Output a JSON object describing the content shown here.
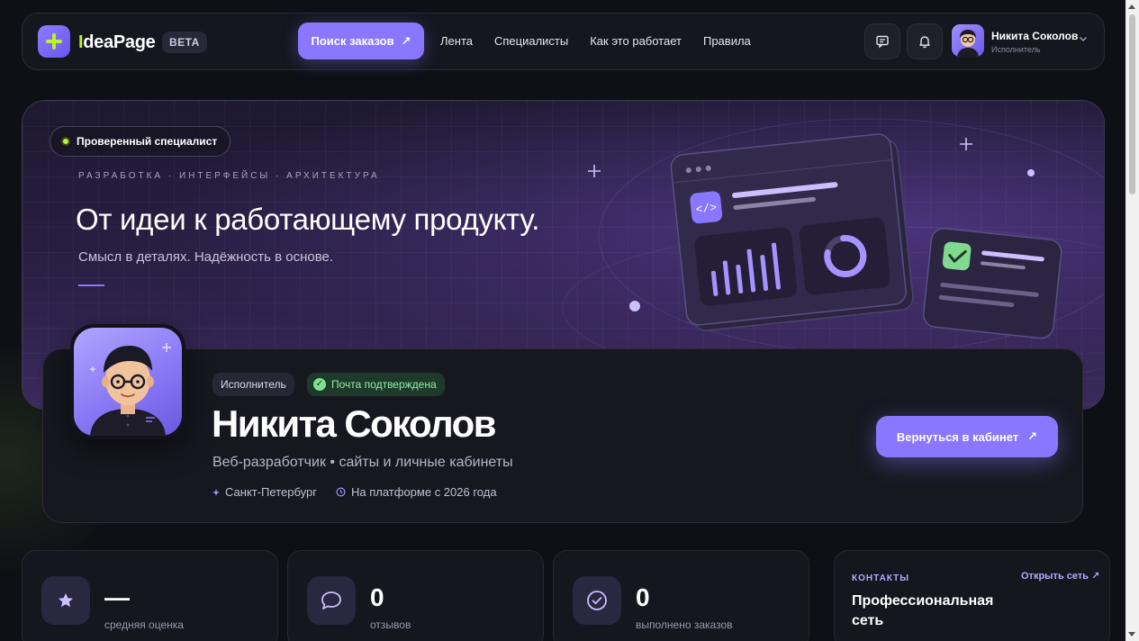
{
  "brand": {
    "name_first": "I",
    "name_rest": "deaPage",
    "badge": "BETA"
  },
  "header": {
    "search_button": "Поиск заказов",
    "nav": [
      "Лента",
      "Специалисты",
      "Как это работает",
      "Правила"
    ],
    "user_name": "Никита Соколов",
    "user_role": "Исполнитель"
  },
  "hero": {
    "chip": "Проверенный специалист",
    "kicker": "РАЗРАБОТКА · ИНТЕРФЕЙСЫ · АРХИТЕКТУРА",
    "title": "От идеи к работающему продукту.",
    "subtitle": "Смысл в деталях. Надёжность в основе."
  },
  "profile": {
    "role_pill": "Исполнитель",
    "email_pill": "Почта подтверждена",
    "name": "Никита Соколов",
    "specialty": "Веб-разработчик • сайты и личные кабинеты",
    "city": "Санкт-Петербург",
    "since": "На платформе с 2026 года",
    "back_button": "Вернуться в кабинет"
  },
  "stats": [
    {
      "value": "—",
      "label": "средняя оценка"
    },
    {
      "value": "0",
      "label": "отзывов"
    },
    {
      "value": "0",
      "label": "выполнено заказов"
    }
  ],
  "contacts": {
    "label": "КОНТАКТЫ",
    "title": "Профессиональная сеть",
    "link": "Открыть сеть"
  },
  "colors": {
    "accent": "#8a77ff",
    "lime": "#b9f22e",
    "success": "#8ff0a4"
  }
}
